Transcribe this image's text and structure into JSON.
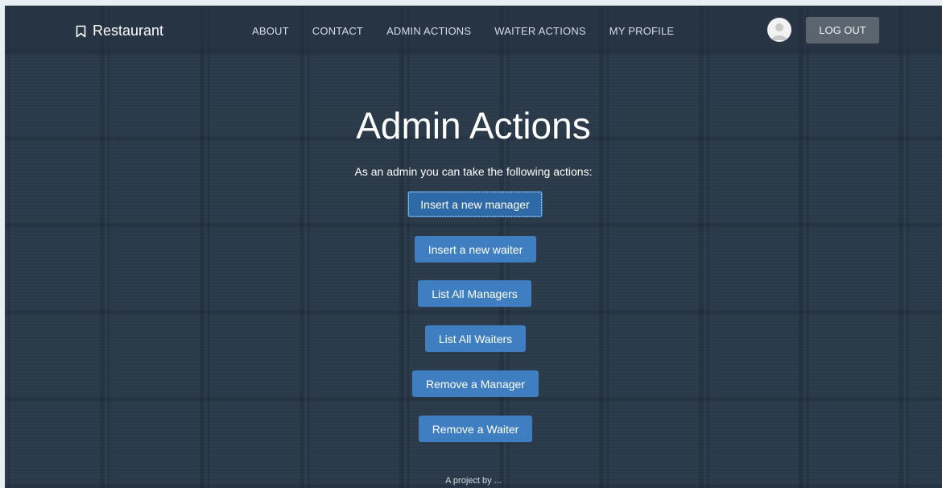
{
  "navbar": {
    "brand": "Restaurant",
    "links": [
      "ABOUT",
      "CONTACT",
      "ADMIN ACTIONS",
      "WAITER ACTIONS",
      "MY PROFILE"
    ],
    "logout": "LOG OUT"
  },
  "main": {
    "title": "Admin Actions",
    "subtitle": "As an admin you can take the following actions:",
    "actions": [
      "Insert a new manager",
      "Insert a new waiter",
      "List All Managers",
      "List All Waiters",
      "Remove a Manager",
      "Remove a Waiter"
    ]
  },
  "footer": {
    "text": "A project by ..."
  },
  "colors": {
    "primary_button": "#3f7fc1",
    "logout_button": "#5a6570"
  },
  "icons": {
    "brand": "bookmark-icon",
    "avatar": "user-avatar-icon"
  }
}
